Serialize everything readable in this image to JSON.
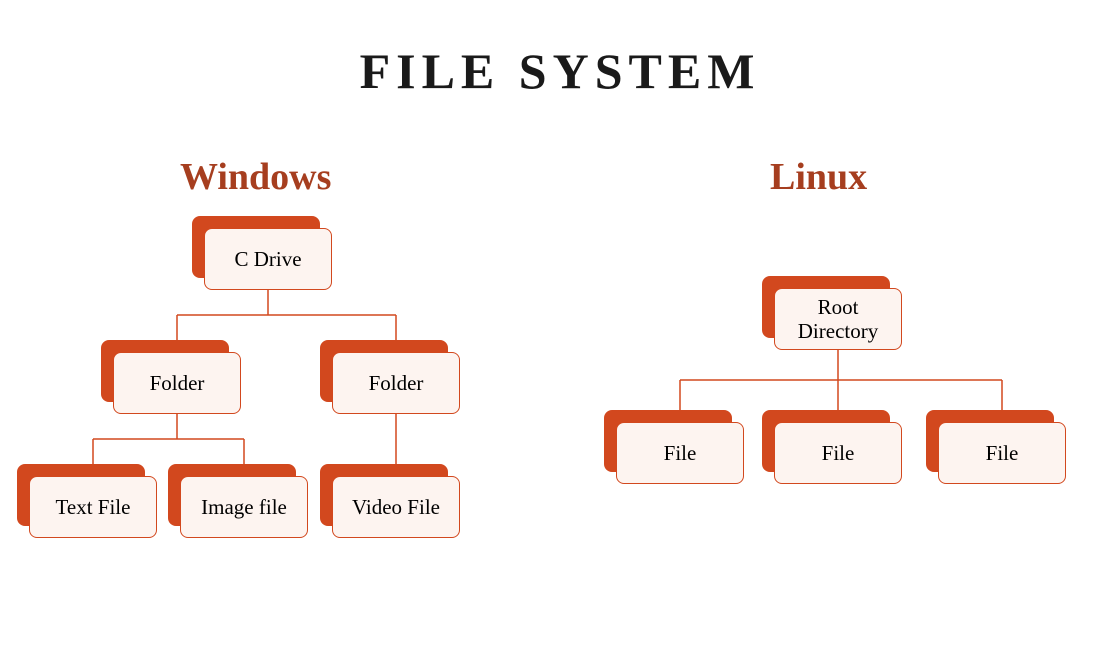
{
  "title": "FILE SYSTEM",
  "windows": {
    "label": "Windows",
    "root": "C Drive",
    "folder1": "Folder",
    "folder2": "Folder",
    "textfile": "Text File",
    "imagefile": "Image file",
    "videofile": "Video File"
  },
  "linux": {
    "label": "Linux",
    "root": "Root Directory",
    "file1": "File",
    "file2": "File",
    "file3": "File"
  }
}
